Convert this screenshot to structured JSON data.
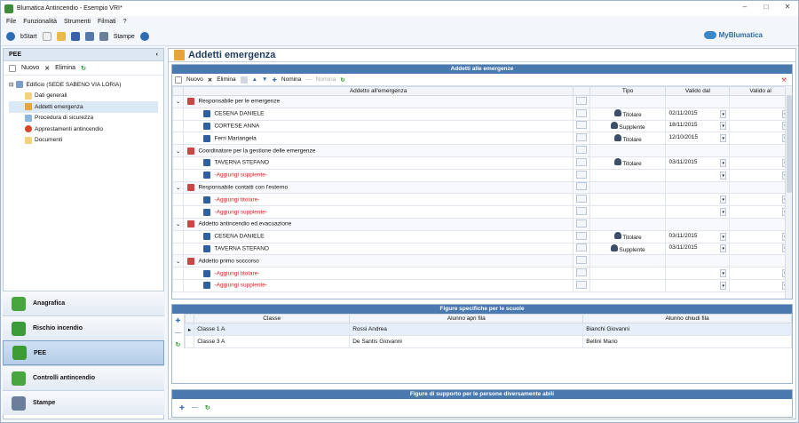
{
  "window": {
    "title": "Blumatica Antincendio - Esempio VRI*"
  },
  "menu": [
    "File",
    "Funzionalità",
    "Strumenti",
    "Filmati",
    "?"
  ],
  "toolbar": {
    "start": "bStart",
    "print": "Stampe"
  },
  "brand": "MyBlumatica",
  "sidebar": {
    "title": "PEE",
    "new": "Nuovo",
    "delete": "Elimina",
    "tree_root": "Edificio (SEDE SABENO VIA LORIA)",
    "tree": [
      "Dati generali",
      "Addetti emergenza",
      "Procedura di sicurezza",
      "Apprestamenti antincendio",
      "Documenti"
    ]
  },
  "nav": [
    "Anagrafica",
    "Rischio incendio",
    "PEE",
    "Controlli antincendio",
    "Stampe"
  ],
  "main": {
    "title": "Addetti emergenza"
  },
  "addetti": {
    "header": "Addetti alle emergenze",
    "new": "Nuovo",
    "delete": "Elimina",
    "nomina1": "Nomina",
    "nomina2": "Nomina",
    "columns": [
      "Addetto all'emergenza",
      "Tipo",
      "Valido dal",
      "Valido al"
    ],
    "rows": [
      {
        "g": 1,
        "name": "Responsabile per le emergenze",
        "tipo": "",
        "dal": "",
        "al": ""
      },
      {
        "g": 0,
        "name": "CESENA DANIELE",
        "tipo": "Titolare",
        "dal": "02/11/2015",
        "al": ""
      },
      {
        "g": 0,
        "name": "CORTESE ANNA",
        "tipo": "Supplente",
        "dal": "18/11/2015",
        "al": ""
      },
      {
        "g": 0,
        "name": "Ferri Mariangela",
        "tipo": "Titolare",
        "dal": "12/10/2015",
        "al": ""
      },
      {
        "g": 1,
        "name": "Coordinatore per la gestione delle emergenze",
        "tipo": "",
        "dal": "",
        "al": ""
      },
      {
        "g": 0,
        "name": "TAVERNA STEFANO",
        "tipo": "Titolare",
        "dal": "03/11/2015",
        "al": ""
      },
      {
        "g": 0,
        "name": "-Aggiungi supplente-",
        "tipo": "",
        "dal": "",
        "al": "",
        "red": true
      },
      {
        "g": 1,
        "name": "Responsabile contatti con l'esterno",
        "tipo": "",
        "dal": "",
        "al": ""
      },
      {
        "g": 0,
        "name": "-Aggiungi titolare-",
        "tipo": "",
        "dal": "",
        "al": "",
        "red": true
      },
      {
        "g": 0,
        "name": "-Aggiungi supplente-",
        "tipo": "",
        "dal": "",
        "al": "",
        "red": true
      },
      {
        "g": 1,
        "name": "Addetto antincendio ed evacuazione",
        "tipo": "",
        "dal": "",
        "al": ""
      },
      {
        "g": 0,
        "name": "CESENA DANIELE",
        "tipo": "Titolare",
        "dal": "03/11/2015",
        "al": ""
      },
      {
        "g": 0,
        "name": "TAVERNA STEFANO",
        "tipo": "Supplente",
        "dal": "03/11/2015",
        "al": ""
      },
      {
        "g": 1,
        "name": "Addetto primo soccorso",
        "tipo": "",
        "dal": "",
        "al": ""
      },
      {
        "g": 0,
        "name": "-Aggiungi titolare-",
        "tipo": "",
        "dal": "",
        "al": "",
        "red": true
      },
      {
        "g": 0,
        "name": "-Aggiungi supplente-",
        "tipo": "",
        "dal": "",
        "al": "",
        "red": true
      }
    ]
  },
  "scuole": {
    "header": "Figure specifiche per le scuole",
    "columns": [
      "Classe",
      "Alunno apri fila",
      "Alunno chiudi fila"
    ],
    "rows": [
      [
        "Classe 1 A",
        "Rossi Andrea",
        "Bianchi Giovanni"
      ],
      [
        "Classe 3 A",
        "De Santis Giovanni",
        "Bellini Mario"
      ]
    ]
  },
  "abili": {
    "header": "Figure di supporto per le persone diversamente abili"
  },
  "colors": {
    "header_blue": "#4a79b0",
    "red": "#e02020"
  }
}
